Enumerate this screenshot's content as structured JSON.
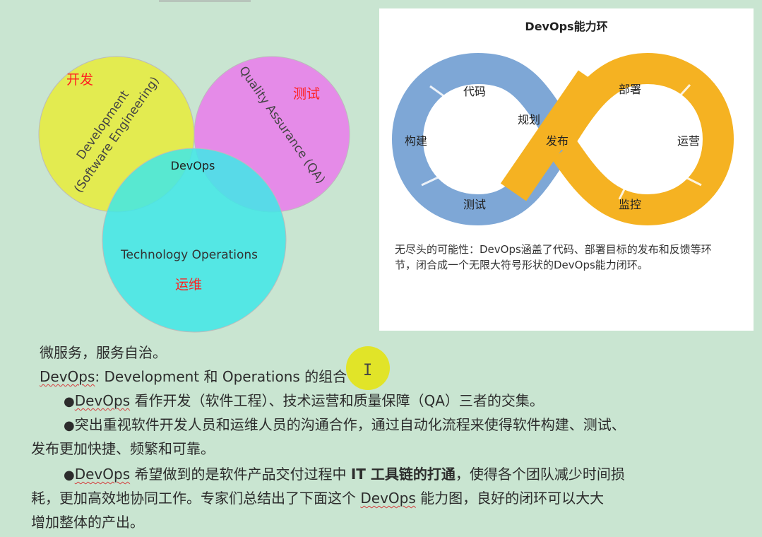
{
  "venn": {
    "circles": [
      {
        "label_line1": "Development",
        "label_line2": "(Software Engineering)",
        "color": "#e8ec3a"
      },
      {
        "label_line1": "Quality Assurance (QA)",
        "label_line2": "",
        "color": "#ea7bec"
      },
      {
        "label_line1": "Technology Operations",
        "label_line2": "",
        "color": "#40e8e8"
      }
    ],
    "center_label": "DevOps",
    "annotations": {
      "dev": "开发",
      "qa": "测试",
      "ops": "运维"
    }
  },
  "loop": {
    "title": "DevOps能力环",
    "left_color": "#7ea7d6",
    "right_color": "#f5b222",
    "stages": {
      "code": "代码",
      "plan": "规划",
      "build": "构建",
      "test": "测试",
      "release": "发布",
      "deploy": "部署",
      "operate": "运营",
      "monitor": "监控"
    },
    "caption": "无尽头的可能性：DevOps涵盖了代码、部署目标的发布和反馈等环节，闭合成一个无限大符号形状的DevOps能力闭环。"
  },
  "notes": {
    "line1": "微服务，服务自治。",
    "line2_a": "DevOps",
    "line2_b": ": Development 和 Operations 的组合",
    "bullet1_a": "DevOps",
    "bullet1_b": " 看作开发（软件工程）、技术运营和质量保障（QA）三者的交集。",
    "bullet2": "突出重视软件开发人员和运维人员的沟通合作，通过自动化流程来使得软件构建、测试、",
    "bullet2_cont": "发布更加快捷、频繁和可靠。",
    "bullet3_a": "DevOps",
    "bullet3_b": " 希望做到的是软件产品交付过程中 ",
    "bullet3_bold": "IT 工具链的打通",
    "bullet3_c": "，使得各个团队减少时间损",
    "bullet3_line2_a": "耗，更加高效地协同工作。专家们总结出了下面这个 ",
    "bullet3_line2_b": "DevOps",
    "bullet3_line2_c": " 能力图，良好的闭环可以大大",
    "bullet3_line3": "增加整体的产出。"
  }
}
